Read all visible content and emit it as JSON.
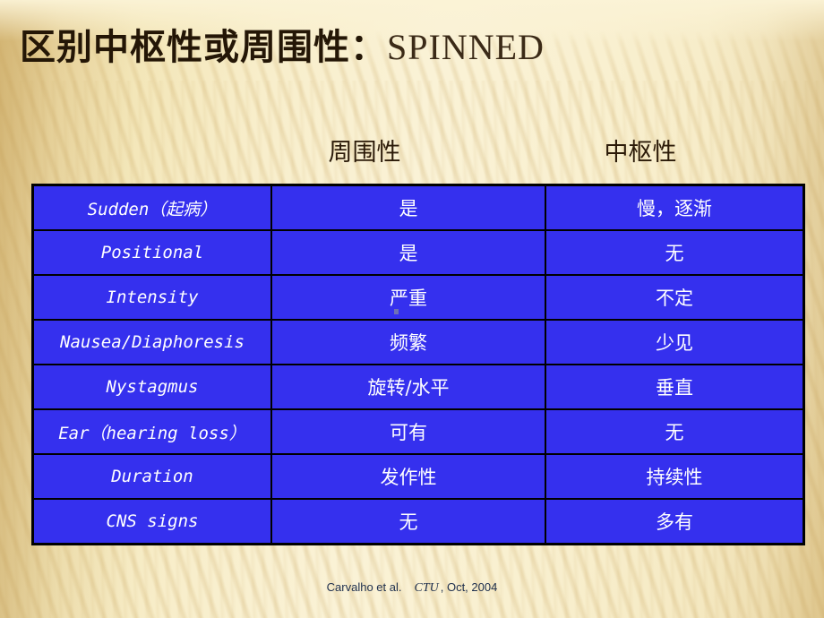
{
  "slide": {
    "title_cjk": "区别中枢性或周围性：",
    "title_latin": "SPINNED",
    "background_color": "#f8eec9",
    "accent_color": "#3530ee"
  },
  "table": {
    "headers": {
      "feature": "",
      "peripheral": "周围性",
      "central": "中枢性"
    },
    "rows": [
      {
        "feature": "Sudden（起病）",
        "peripheral": "是",
        "central": "慢，逐渐"
      },
      {
        "feature": "Positional",
        "peripheral": "是",
        "central": "无"
      },
      {
        "feature": "Intensity",
        "peripheral": "严重",
        "central": "不定"
      },
      {
        "feature": "Nausea/Diaphoresis",
        "peripheral": "频繁",
        "central": "少见"
      },
      {
        "feature": "Nystagmus",
        "peripheral": "旋转/水平",
        "central": "垂直"
      },
      {
        "feature": "Ear（hearing loss）",
        "peripheral": "可有",
        "central": "无"
      },
      {
        "feature": "Duration",
        "peripheral": "发作性",
        "central": "持续性"
      },
      {
        "feature": "CNS signs",
        "peripheral": "无",
        "central": "多有"
      }
    ]
  },
  "citation": {
    "authors": "Carvalho et al.",
    "journal": "CTU",
    "date": ", Oct, 2004"
  }
}
